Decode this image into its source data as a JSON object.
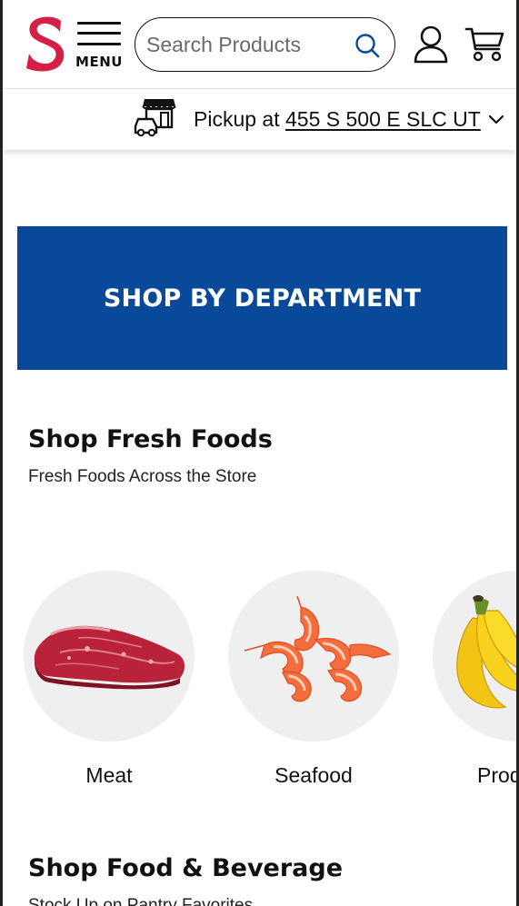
{
  "header": {
    "logo_letter": "S",
    "menu_label": "MENU",
    "search_placeholder": "Search Products",
    "icons": {
      "search": "search-icon",
      "account": "user-icon",
      "cart": "cart-icon",
      "menu": "hamburger-icon"
    }
  },
  "pickup": {
    "prefix": "Pickup at ",
    "address": "455 S 500 E SLC UT",
    "icon": "store-car-icon"
  },
  "banner": {
    "label": "SHOP BY DEPARTMENT"
  },
  "sections": [
    {
      "title": "Shop Fresh Foods",
      "subtitle": "Fresh Foods Across the Store",
      "categories": [
        {
          "label": "Meat",
          "image": "steak"
        },
        {
          "label": "Seafood",
          "image": "shrimp"
        },
        {
          "label": "Prod",
          "image": "bananas"
        }
      ]
    },
    {
      "title": "Shop Food & Beverage",
      "subtitle": "Stock Up on Pantry Favorites"
    }
  ],
  "colors": {
    "brand_red": "#d61f45",
    "banner_blue": "#084a99",
    "circle_bg": "#efefef"
  }
}
